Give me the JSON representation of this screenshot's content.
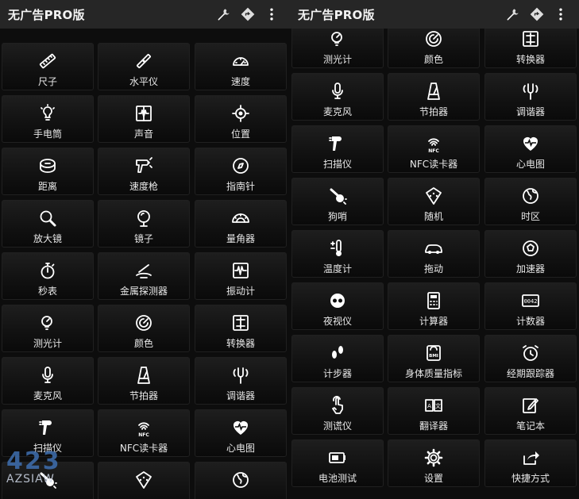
{
  "left_pane": {
    "title": "无广告PRO版",
    "actions": [
      {
        "icon": "wrench-icon"
      },
      {
        "icon": "directions-icon"
      },
      {
        "icon": "more-vert-icon"
      }
    ],
    "tiles": [
      {
        "label": "尺子",
        "icon": "ruler-icon"
      },
      {
        "label": "水平仪",
        "icon": "level-icon"
      },
      {
        "label": "速度",
        "icon": "speedometer-icon"
      },
      {
        "label": "手电筒",
        "icon": "bulb-icon"
      },
      {
        "label": "声音",
        "icon": "sound-icon"
      },
      {
        "label": "位置",
        "icon": "location-icon"
      },
      {
        "label": "距离",
        "icon": "tape-icon"
      },
      {
        "label": "速度枪",
        "icon": "speed-gun-icon"
      },
      {
        "label": "指南针",
        "icon": "compass-icon"
      },
      {
        "label": "放大镜",
        "icon": "magnifier-icon"
      },
      {
        "label": "镜子",
        "icon": "mirror-icon"
      },
      {
        "label": "量角器",
        "icon": "protractor-icon"
      },
      {
        "label": "秒表",
        "icon": "stopwatch-icon"
      },
      {
        "label": "金属探测器",
        "icon": "metal-detector-icon"
      },
      {
        "label": "振动计",
        "icon": "vibration-icon"
      },
      {
        "label": "测光计",
        "icon": "light-meter-icon"
      },
      {
        "label": "颜色",
        "icon": "color-icon"
      },
      {
        "label": "转换器",
        "icon": "converter-icon"
      },
      {
        "label": "麦克风",
        "icon": "microphone-icon"
      },
      {
        "label": "节拍器",
        "icon": "metronome-icon"
      },
      {
        "label": "调谐器",
        "icon": "tuner-icon"
      },
      {
        "label": "扫描仪",
        "icon": "scanner-icon"
      },
      {
        "label": "NFC读卡器",
        "icon": "nfc-icon"
      },
      {
        "label": "心电图",
        "icon": "heart-icon"
      },
      {
        "label": "",
        "icon": "dog-whistle-icon"
      },
      {
        "label": "",
        "icon": "dice-icon"
      },
      {
        "label": "",
        "icon": "globe-icon"
      }
    ]
  },
  "right_pane": {
    "title": "无广告PRO版",
    "actions": [
      {
        "icon": "wrench-icon"
      },
      {
        "icon": "directions-icon"
      },
      {
        "icon": "more-vert-icon"
      }
    ],
    "tiles": [
      {
        "label": "测光计",
        "icon": "light-meter-icon"
      },
      {
        "label": "颜色",
        "icon": "color-icon"
      },
      {
        "label": "转换器",
        "icon": "converter-icon"
      },
      {
        "label": "麦克风",
        "icon": "microphone-icon"
      },
      {
        "label": "节拍器",
        "icon": "metronome-icon"
      },
      {
        "label": "调谐器",
        "icon": "tuner-icon"
      },
      {
        "label": "扫描仪",
        "icon": "scanner-icon"
      },
      {
        "label": "NFC读卡器",
        "icon": "nfc-icon"
      },
      {
        "label": "心电图",
        "icon": "heart-icon"
      },
      {
        "label": "狗哨",
        "icon": "dog-whistle-icon"
      },
      {
        "label": "随机",
        "icon": "dice-icon"
      },
      {
        "label": "时区",
        "icon": "globe-icon"
      },
      {
        "label": "温度计",
        "icon": "thermometer-icon"
      },
      {
        "label": "拖动",
        "icon": "car-icon"
      },
      {
        "label": "加速器",
        "icon": "accelerometer-icon"
      },
      {
        "label": "夜视仪",
        "icon": "night-vision-icon"
      },
      {
        "label": "计算器",
        "icon": "calculator-icon"
      },
      {
        "label": "计数器",
        "icon": "counter-icon"
      },
      {
        "label": "计步器",
        "icon": "footsteps-icon"
      },
      {
        "label": "身体质量指标",
        "icon": "bmi-icon"
      },
      {
        "label": "经期跟踪器",
        "icon": "alarm-icon"
      },
      {
        "label": "测谎仪",
        "icon": "touch-icon"
      },
      {
        "label": "翻译器",
        "icon": "translate-icon"
      },
      {
        "label": "笔记本",
        "icon": "note-icon"
      },
      {
        "label": "电池测试",
        "icon": "battery-icon"
      },
      {
        "label": "设置",
        "icon": "gear-icon"
      },
      {
        "label": "快捷方式",
        "icon": "share-icon"
      }
    ]
  },
  "watermark": {
    "line1": "423",
    "line2": "AZSIAW"
  },
  "colors": {
    "appbar": "#262626",
    "tile": "#141414",
    "background": "#0d0d0d",
    "text": "#e8e8e8"
  }
}
